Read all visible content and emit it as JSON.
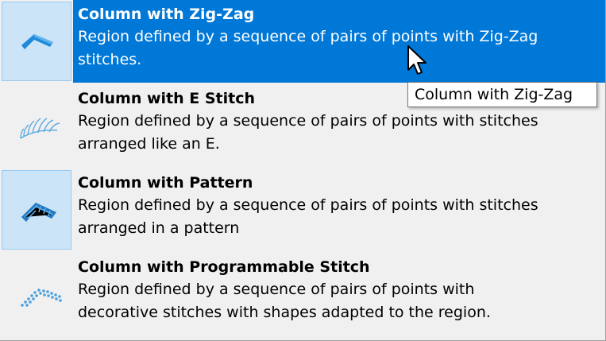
{
  "menu": {
    "items": [
      {
        "title": "Column with Zig-Zag",
        "description": "Region defined by a sequence of pairs of points with Zig-Zag stitches.",
        "icon": "zigzag-column-icon",
        "selected": true,
        "checked": true
      },
      {
        "title": "Column with E Stitch",
        "description": "Region defined by a sequence of pairs of points with stitches arranged like an E.",
        "icon": "e-stitch-column-icon",
        "selected": false,
        "checked": false
      },
      {
        "title": "Column with Pattern",
        "description": "Region defined by a sequence of pairs of points with stitches arranged in a pattern",
        "icon": "pattern-column-icon",
        "selected": false,
        "checked": true
      },
      {
        "title": "Column with Programmable Stitch",
        "description": "Region defined by a sequence of pairs of points with decorative stitches with shapes adapted to the region.",
        "icon": "programmable-stitch-column-icon",
        "selected": false,
        "checked": false
      }
    ]
  },
  "tooltip": {
    "text": "Column with Zig-Zag"
  },
  "colors": {
    "highlight": "#0078d7",
    "checked_bg": "#cce4f7",
    "menu_bg": "#f0f0f0",
    "icon_blue": "#1f8ad9"
  }
}
